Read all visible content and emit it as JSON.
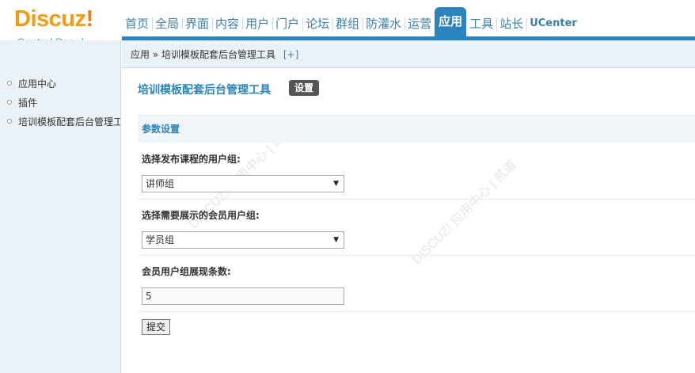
{
  "logo": {
    "brand": "Discuz",
    "bang": "!",
    "sub": "Control Panel"
  },
  "topnav": [
    {
      "label": "首页"
    },
    {
      "label": "全局"
    },
    {
      "label": "界面"
    },
    {
      "label": "内容"
    },
    {
      "label": "用户"
    },
    {
      "label": "门户"
    },
    {
      "label": "论坛"
    },
    {
      "label": "群组"
    },
    {
      "label": "防灌水"
    },
    {
      "label": "运营"
    },
    {
      "label": "应用",
      "active": true
    },
    {
      "label": "工具"
    },
    {
      "label": "站长"
    },
    {
      "label": "UCenter"
    }
  ],
  "sidebar": {
    "items": [
      {
        "label": "应用中心"
      },
      {
        "label": "插件"
      },
      {
        "label": "培训模板配套后台管理工具"
      }
    ]
  },
  "breadcrumb": {
    "root": "应用",
    "sep": "»",
    "current": "培训模板配套后台管理工具",
    "plus": "[+]"
  },
  "main": {
    "title": "培训模板配套后台管理工具",
    "tab": "设置",
    "section": "参数设置",
    "fields": {
      "teacher_group_label": "选择发布课程的用户组:",
      "teacher_group_value": "讲师组",
      "member_group_label": "选择需要展示的会员用户组:",
      "member_group_value": "学员组",
      "count_label": "会员用户组展现条数:",
      "count_value": "5"
    },
    "submit": "提交"
  },
  "colors": {
    "accent": "#2b84bd",
    "logo": "#f39c12",
    "sidebar_bg": "#eaf1f7"
  }
}
